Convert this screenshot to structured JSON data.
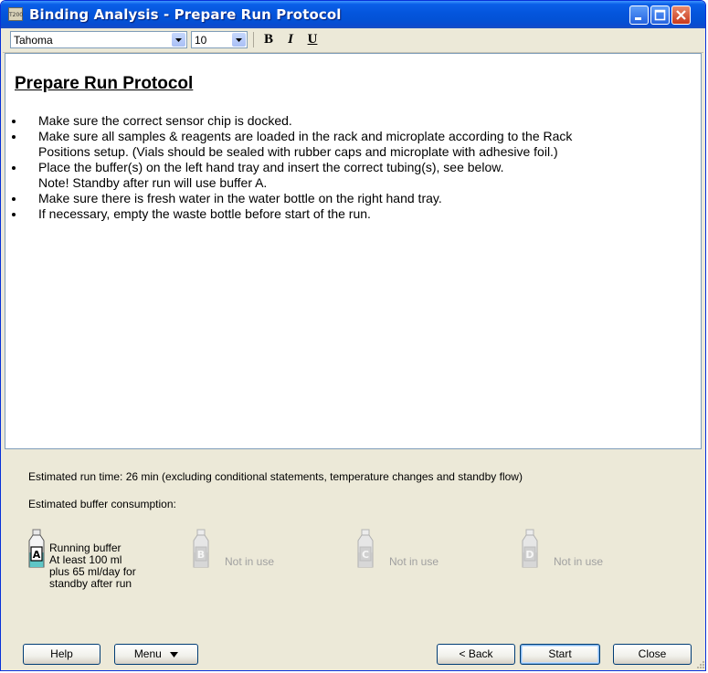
{
  "window": {
    "title": "Binding Analysis - Prepare Run Protocol",
    "icon_text": "T200"
  },
  "toolbar": {
    "font": "Tahoma",
    "size": "10",
    "bold": "B",
    "italic": "I",
    "underline": "U"
  },
  "document": {
    "heading": "Prepare Run Protocol",
    "bullets": [
      {
        "lines": [
          "Make sure the correct sensor chip is docked."
        ]
      },
      {
        "lines": [
          "Make sure all samples & reagents are loaded in the rack and microplate according to the Rack",
          "Positions setup. (Vials should be sealed with rubber caps and microplate with adhesive foil.)"
        ]
      },
      {
        "lines": [
          "Place the buffer(s) on the left hand tray and insert the correct tubing(s), see below.",
          "Note! Standby after run will use buffer A."
        ]
      },
      {
        "lines": [
          "Make sure there is fresh water in the water bottle on the right hand tray."
        ]
      },
      {
        "lines": [
          "If necessary, empty the waste bottle before start of the run."
        ]
      }
    ]
  },
  "estimates": {
    "run_time": "Estimated run time:  26 min  (excluding conditional statements, temperature changes and standby flow)",
    "buffer_consumption": "Estimated buffer consumption:"
  },
  "buffers": [
    {
      "letter": "A",
      "active": true,
      "lines": [
        "Running buffer",
        "At least 100 ml",
        "plus 65 ml/day for",
        "standby after run"
      ]
    },
    {
      "letter": "B",
      "active": false,
      "lines": [
        "Not in use"
      ]
    },
    {
      "letter": "C",
      "active": false,
      "lines": [
        "Not in use"
      ]
    },
    {
      "letter": "D",
      "active": false,
      "lines": [
        "Not in use"
      ]
    }
  ],
  "buttons": {
    "help": "Help",
    "menu": "Menu",
    "back": "< Back",
    "start": "Start",
    "close": "Close"
  },
  "colors": {
    "titlebar": "#0455dc",
    "panel": "#ece9d8",
    "bottle_active": "#5ec6c6"
  }
}
